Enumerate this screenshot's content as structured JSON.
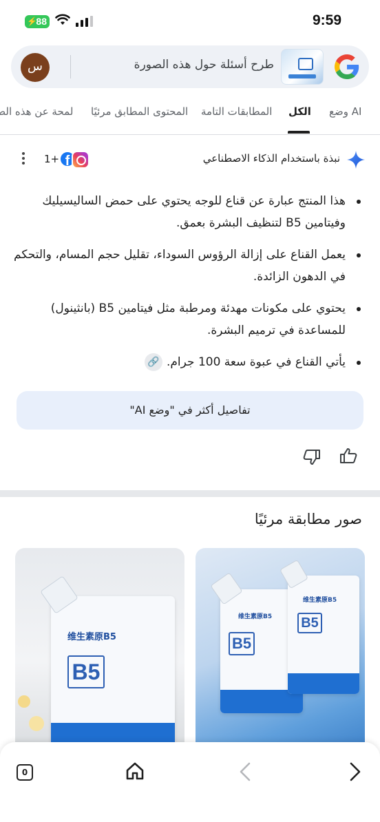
{
  "status_bar": {
    "battery": "88",
    "time": "9:59"
  },
  "search": {
    "placeholder": "طرح أسئلة حول هذه الصورة",
    "avatar_letter": "س"
  },
  "tabs": [
    {
      "label": "وضع AI"
    },
    {
      "label": "الكل"
    },
    {
      "label": "المطابقات التامة"
    },
    {
      "label": "المحتوى المطابق مرئيًا"
    },
    {
      "label": "لمحة عن هذه الص"
    }
  ],
  "ai_overview": {
    "title": "نبذة باستخدام الذكاء الاصطناعي",
    "sources_more": "1+",
    "bullets": [
      "هذا المنتج عبارة عن قناع للوجه يحتوي على حمض الساليسيليك وفيتامين B5 لتنظيف البشرة بعمق.",
      "يعمل القناع على إزالة الرؤوس السوداء، تقليل حجم المسام، والتحكم في الدهون الزائدة.",
      "يحتوي على مكونات مهدئة ومرطبة مثل فيتامين B5 (بانثينول) للمساعدة في ترميم البشرة.",
      "يأتي القناع في عبوة سعة 100 جرام."
    ],
    "details_button": "تفاصيل أكثر في \"وضع AI\""
  },
  "visual_matches": {
    "title": "صور مطابقة مرئيًا",
    "pouch_brand": "维生素原B5",
    "pouch_logo": "B5"
  },
  "bottom_nav": {
    "tab_count": "0"
  },
  "colors": {
    "accent": "#1a73e8",
    "chip_bg": "#e8effb",
    "battery": "#34c759"
  }
}
